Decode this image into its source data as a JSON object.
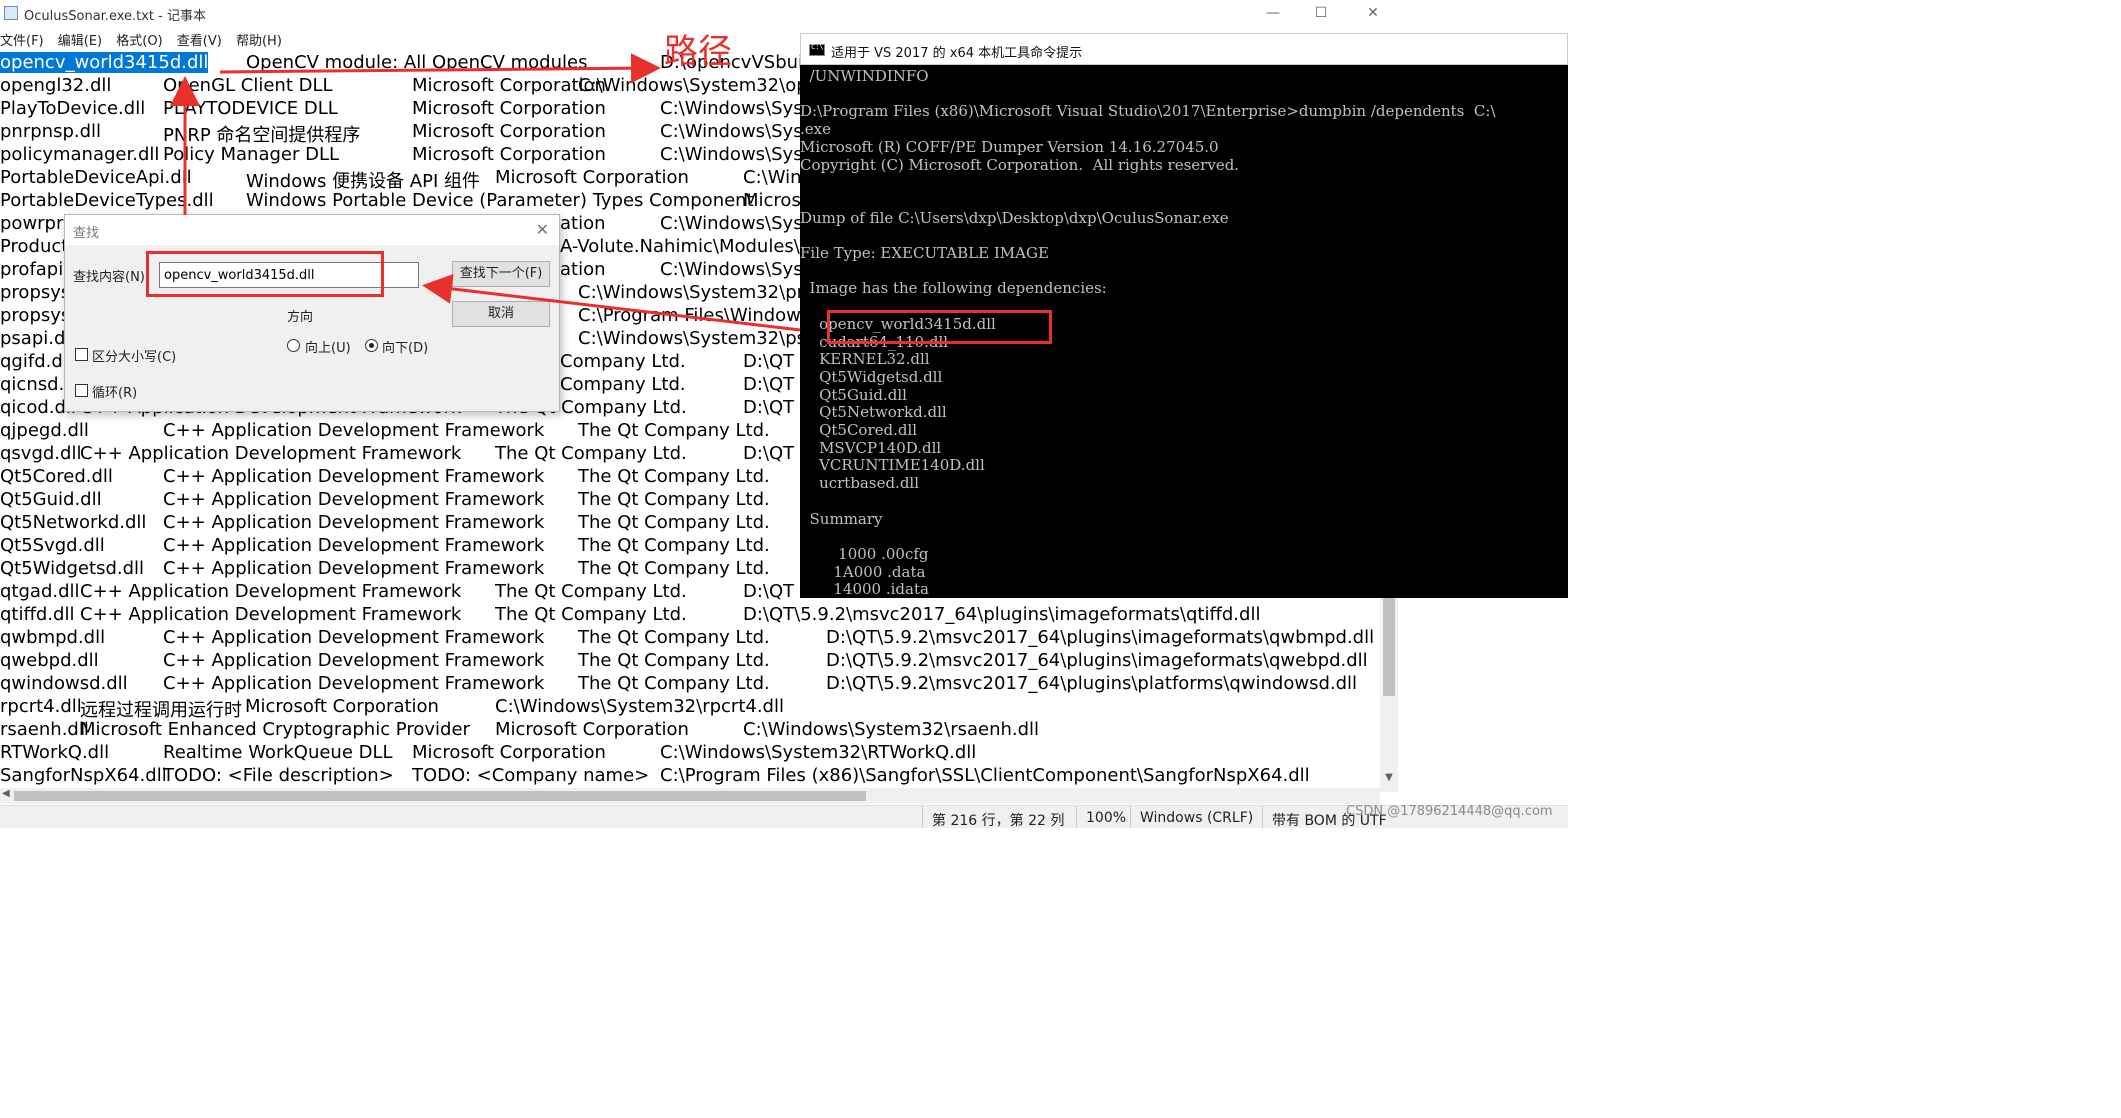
{
  "notepad": {
    "title": "OculusSonar.exe.txt - 记事本",
    "menu": [
      "文件(F)",
      "编辑(E)",
      "格式(O)",
      "查看(V)",
      "帮助(H)"
    ],
    "lines": [
      [
        "opencv_world3415d.dll",
        "OpenCV module: All OpenCV modules",
        "D:\\opencvVSbuil"
      ],
      [
        "opengl32.dll",
        "OpenGL Client DLL",
        "Microsoft Corporation",
        "C:\\Windows\\System32\\op"
      ],
      [
        "PlayToDevice.dll",
        "PLAYTODEVICE DLL",
        "Microsoft Corporation",
        "C:\\Windows\\Sys"
      ],
      [
        "pnrpnsp.dll",
        "PNRP 命名空间提供程序",
        "Microsoft Corporation",
        "C:\\Windows\\Sys"
      ],
      [
        "policymanager.dll",
        "Policy Manager DLL",
        "Microsoft Corporation",
        "C:\\Windows\\Sys"
      ],
      [
        "PortableDeviceApi.dll",
        "Windows 便携设备 API 组件",
        "Microsoft Corporation",
        "C:\\Win"
      ],
      [
        "PortableDeviceTypes.dll",
        "Windows Portable Device (Parameter) Types Component",
        "Micros"
      ],
      [
        "powrpro",
        "ation",
        "C:\\Windows\\Sys"
      ],
      [
        "Product",
        "A-Volute.Nahimic\\Modules\\S"
      ],
      [
        "profapi.",
        "ation",
        "C:\\Windows\\Sys"
      ],
      [
        "propsys",
        "C:\\Windows\\System32\\pro"
      ],
      [
        "propsys",
        "C:\\Program Files\\Windows"
      ],
      [
        "psapi.dl",
        "C:\\Windows\\System32\\psa"
      ],
      [
        "qgifd.dl",
        "Company Ltd.",
        "D:\\QT"
      ],
      [
        "qicnsd.d",
        "Company Ltd.",
        "D:\\QT"
      ],
      [
        "qicod.dll",
        "C++ Application Development Framework",
        "The Qt Company Ltd.",
        "D:\\QT"
      ],
      [
        "qjpegd.dll",
        "C++ Application Development Framework",
        "The Qt Company Ltd."
      ],
      [
        "qsvgd.dll",
        "C++ Application Development Framework",
        "The Qt Company Ltd.",
        "D:\\QT"
      ],
      [
        "Qt5Cored.dll",
        "C++ Application Development Framework",
        "The Qt Company Ltd."
      ],
      [
        "Qt5Guid.dll",
        "C++ Application Development Framework",
        "The Qt Company Ltd."
      ],
      [
        "Qt5Networkd.dll",
        "C++ Application Development Framework",
        "The Qt Company Ltd."
      ],
      [
        "Qt5Svgd.dll",
        "C++ Application Development Framework",
        "The Qt Company Ltd."
      ],
      [
        "Qt5Widgetsd.dll",
        "C++ Application Development Framework",
        "The Qt Company Ltd."
      ],
      [
        "qtgad.dll",
        "C++ Application Development Framework",
        "The Qt Company Ltd.",
        "D:\\QT"
      ],
      [
        "qtiffd.dll",
        "C++ Application Development Framework",
        "The Qt Company Ltd.",
        "D:\\QT\\5.9.2\\msvc2017_64\\plugins\\imageformats\\qtiffd.dll"
      ],
      [
        "qwbmpd.dll",
        "C++ Application Development Framework",
        "The Qt Company Ltd.",
        "D:\\QT\\5.9.2\\msvc2017_64\\plugins\\imageformats\\qwbmpd.dll"
      ],
      [
        "qwebpd.dll",
        "C++ Application Development Framework",
        "The Qt Company Ltd.",
        "D:\\QT\\5.9.2\\msvc2017_64\\plugins\\imageformats\\qwebpd.dll"
      ],
      [
        "qwindowsd.dll",
        "C++ Application Development Framework",
        "The Qt Company Ltd.",
        "D:\\QT\\5.9.2\\msvc2017_64\\plugins\\platforms\\qwindowsd.dll"
      ],
      [
        "rpcrt4.dll",
        "远程过程调用运行时",
        "Microsoft Corporation",
        "C:\\Windows\\System32\\rpcrt4.dll"
      ],
      [
        "rsaenh.dll",
        "Microsoft Enhanced Cryptographic Provider",
        "Microsoft Corporation",
        "C:\\Windows\\System32\\rsaenh.dll"
      ],
      [
        "RTWorkQ.dll",
        "Realtime WorkQueue DLL",
        "Microsoft Corporation",
        "C:\\Windows\\System32\\RTWorkQ.dll"
      ],
      [
        "SangforNspX64.dll",
        "TODO: <File description>",
        "TODO: <Company name>",
        "C:\\Program Files (x86)\\Sangfor\\SSL\\ClientComponent\\SangforNspX64.dll"
      ]
    ],
    "status": {
      "position": "第 216 行，第 22 列",
      "zoom": "100%",
      "eol": "Windows (CRLF)",
      "encoding": "带有 BOM 的 UTF"
    }
  },
  "find_dialog": {
    "title": "查找",
    "label": "查找内容(N):",
    "value": "opencv_world3415d.dll",
    "find_next": "查找下一个(F)",
    "cancel": "取消",
    "direction_label": "方向",
    "up": "向上(U)",
    "down": "向下(D)",
    "match_case": "区分大小写(C)",
    "wrap": "循环(R)"
  },
  "console": {
    "title": "适用于 VS 2017 的 x64 本机工具命令提示",
    "lines": [
      "  /UNWINDINFO",
      "",
      "D:\\Program Files (x86)\\Microsoft Visual Studio\\2017\\Enterprise>dumpbin /dependents  C:\\",
      ".exe",
      "Microsoft (R) COFF/PE Dumper Version 14.16.27045.0",
      "Copyright (C) Microsoft Corporation.  All rights reserved.",
      "",
      "",
      "Dump of file C:\\Users\\dxp\\Desktop\\dxp\\OculusSonar.exe",
      "",
      "File Type: EXECUTABLE IMAGE",
      "",
      "  Image has the following dependencies:",
      "",
      "    opencv_world3415d.dll",
      "    cudart64_110.dll",
      "    KERNEL32.dll",
      "    Qt5Widgetsd.dll",
      "    Qt5Guid.dll",
      "    Qt5Networkd.dll",
      "    Qt5Cored.dll",
      "    MSVCP140D.dll",
      "    VCRUNTIME140D.dll",
      "    ucrtbased.dll",
      "",
      "  Summary",
      "",
      "        1000 .00cfg",
      "       1A000 .data",
      "       14000 .idata"
    ]
  },
  "annotation": {
    "label": "路径",
    "color": "#e8302c"
  },
  "watermark": "CSDN @17896214448@qq.com",
  "colors": {
    "selection": "#0078d7",
    "console_bg": "#000000",
    "console_text": "#c0c0c0"
  }
}
